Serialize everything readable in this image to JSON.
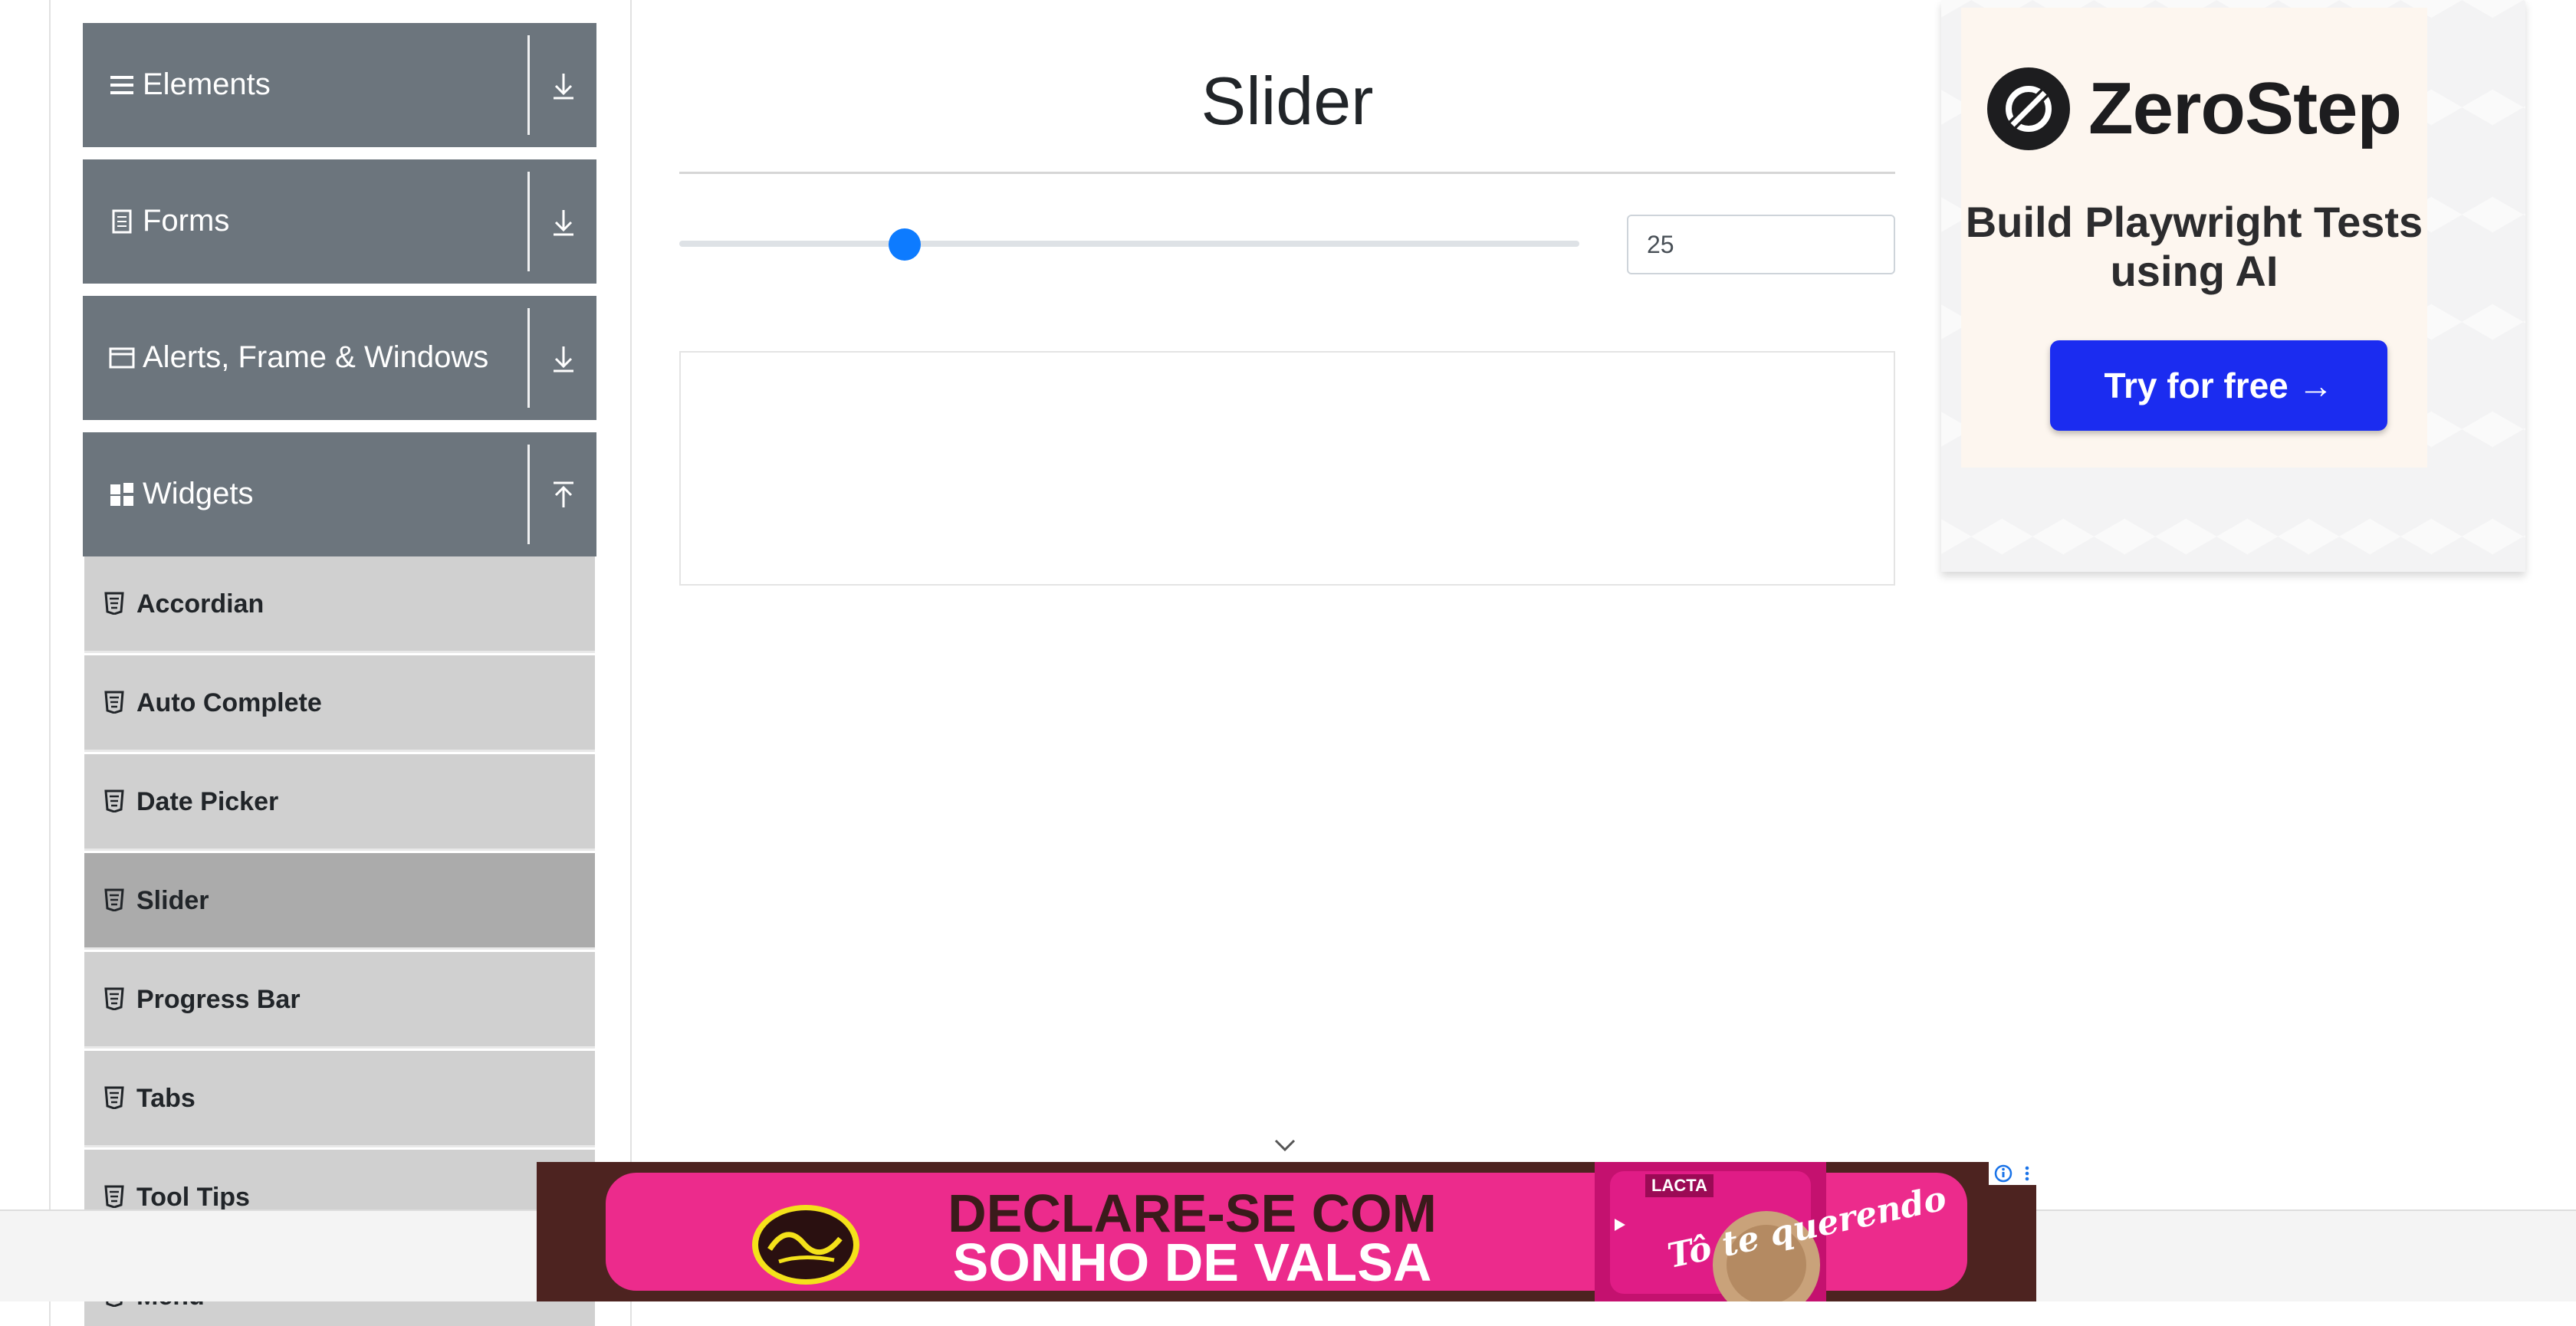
{
  "sidebar": {
    "groups": [
      {
        "label": "Elements",
        "icon": "list-icon",
        "toggle": "expand-arrow-icon"
      },
      {
        "label": "Forms",
        "icon": "form-icon",
        "toggle": "expand-arrow-icon"
      },
      {
        "label": "Alerts, Frame & Windows",
        "icon": "window-icon",
        "toggle": "expand-arrow-icon"
      },
      {
        "label": "Widgets",
        "icon": "widgets-icon",
        "toggle": "collapse-arrow-icon"
      }
    ],
    "widget_items": [
      {
        "label": "Accordian"
      },
      {
        "label": "Auto Complete"
      },
      {
        "label": "Date Picker"
      },
      {
        "label": "Slider",
        "active": true
      },
      {
        "label": "Progress Bar"
      },
      {
        "label": "Tabs"
      },
      {
        "label": "Tool Tips"
      },
      {
        "label": "Menu"
      }
    ],
    "header_color": "#6c757d",
    "item_color": "#d0d0d0",
    "active_item_color": "#ababab"
  },
  "main": {
    "title": "Slider",
    "slider": {
      "min": 0,
      "max": 100,
      "value": 25,
      "value_text": "25",
      "accent": "#0d7bff"
    }
  },
  "side_ad": {
    "brand": "ZeroStep",
    "tagline": "Build Playwright Tests using AI",
    "cta": "Try for free →",
    "cta_color": "#1b2cf0"
  },
  "bottom_ad": {
    "line1": "DECLARE-SE COM",
    "line2": "SONHO DE VALSA",
    "product_brand": "LACTA",
    "product_slogan": "Tô te querendo",
    "band_color": "#ec2b8c",
    "background_color": "#4d2320",
    "info_icons": [
      "info-icon",
      "more-options-icon"
    ]
  }
}
